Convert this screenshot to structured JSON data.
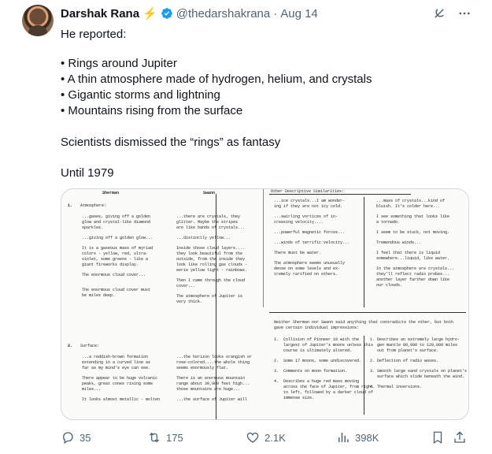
{
  "tweet": {
    "author_name": "Darshak Rana",
    "handle": "@thedarshakrana",
    "separator": "·",
    "date": "Aug 14",
    "intro": "He reported:",
    "bullets": [
      "Rings around Jupiter",
      "A thin atmosphere made of hydrogen, helium, and crystals",
      "Gigantic storms and lightning",
      "Mountains rising from the surface"
    ],
    "para1": "Scientists dismissed the “rings” as fantasy",
    "para2": "Until 1979"
  },
  "icons": {
    "bolt": "lightning-bolt-icon",
    "verified": "verified-badge-icon",
    "grok": "grok-icon",
    "more": "more-icon",
    "reply": "reply-icon",
    "retweet": "retweet-icon",
    "like": "like-icon",
    "views": "views-icon",
    "bookmark": "bookmark-icon",
    "share": "share-icon"
  },
  "colors": {
    "accent": "#1d9bf0",
    "text": "#0f1419",
    "secondary": "#536471",
    "bolt": "#f5c518"
  },
  "actions": {
    "replies": "35",
    "reposts": "175",
    "likes": "2.1K",
    "views": "398K"
  },
  "document": {
    "left_headers": [
      "Sherman",
      "Swann"
    ],
    "sections": [
      "1.",
      "Atmosphere:",
      "2.",
      "Surface:"
    ],
    "sherman_atmosphere": [
      "...gases, giving off a golden\nglow and crystal-like diamond\nsparkles.",
      "...giving off a golden glow...",
      "It is a gaseous mass of myriad\ncolors - yellow, red, ultra-\nviolet, some greens - like a\ngiant fireworks display.",
      "The enormous cloud cover...",
      "The enormous cloud cover must\nbe miles deep."
    ],
    "swann_atmosphere": [
      "...there are crystals, they\nglitter. Maybe the stripes\nare like bands of crystals...",
      "...distinctly yellow...",
      "Inside those cloud layers....\nthey look beautiful from the\noutside, from the inside they\nlook like rolling gas clouds -\neerie yellow light - rainbows.",
      "Then I came through the cloud\ncover...",
      "The atmosphere of Jupiter is\nvery thick."
    ],
    "sherman_surface": [
      "...a reddish-brown formation\nextending in a curved line as\nfar as my mind's eye can see.",
      "There appear to be huge volcanic\npeaks, great cones rising some\nmiles...",
      "It looks almost metallic - molten"
    ],
    "swann_surface": [
      "...the horizon looks orangish or\nrose-colored....the whole thing\nseems enormously flat.",
      "There is an enormous mountain\nrange about 30,000 feet high...\nthose mountains are huge...",
      "...the surface of Jupiter will"
    ],
    "right_top_header": "Other Descriptive Similarities:",
    "right_col1": [
      "...ice crystals...I am wonder-\ning if they are not icy cold.",
      "...swirling vortices of in-\ncreasing velocity....",
      "...powerful magnetic forces...",
      "...winds of terrific velocity...",
      "There must be water.",
      "The atmosphere seems unusually\ndense on some levels and ex-\ntremely rarified on others."
    ],
    "right_col2": [
      "...mass of crystals...kind of\nbluish. It's colder here...",
      "I see something that looks like\na tornado.",
      "I seem to be stuck, not moving.",
      "Tremendous winds...",
      "I feel that there is liquid\nsomewhere...liquid, like water.",
      "In the atmosphere are crystals...\nthey'll reflect radio probes...\nanother layer farther down like\nour clouds."
    ],
    "summary": "Neither Sherman nor Swann said anything that contradicts the other, but both\ngave certain individual impressions:",
    "sherman_points": [
      "1.  Collision of Pioneer 10 with the\n    largest of Jupiter's moons unless this\n    course is ultimately altered.",
      "2.  Some 17 moons, some undiscovered.",
      "3.  Comments on moon formation.",
      "4.  Describes a huge red mass moving\n    across the face of Jupiter, from right\n    to left, followed by a darker cloud of\n    immense size."
    ],
    "swann_points": [
      "1. Describes an extremely large hydro-\n   gen mantle 80,000 to 120,000 miles\n   out from planet's surface.",
      "2. Deflection of radio waves.",
      "3. Smooth large sand crystals on planet's\n   surface which slide beneath the wind.",
      "4. Thermal inversions."
    ]
  }
}
